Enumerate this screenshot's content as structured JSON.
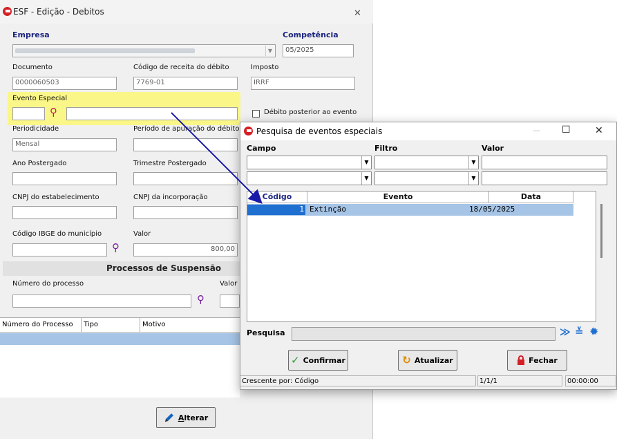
{
  "main_window": {
    "title": "ESF - Edição - Debitos",
    "close_glyph": "✕",
    "empresa_label": "Empresa",
    "empresa_value": "",
    "competencia_label": "Competência",
    "competencia_value": "05/2025",
    "documento_label": "Documento",
    "documento_value": "0000060503",
    "codigo_receita_label": "Código de receita do débito",
    "codigo_receita_value": "7769-01",
    "imposto_label": "Imposto",
    "imposto_value": "IRRF",
    "evento_especial_label": "Evento Especial",
    "debito_posterior_label": "Débito posterior ao evento",
    "periodicidade_label": "Periodicidade",
    "periodicidade_value": "Mensal",
    "periodo_apuracao_label": "Período de apuração do débito",
    "ano_postergado_label": "Ano Postergado",
    "trimestre_postergado_label": "Trimestre Postergado",
    "cnpj_estab_label": "CNPJ do estabelecimento",
    "cnpj_incorp_label": "CNPJ da incorporação",
    "codigo_ibge_label": "Código IBGE do município",
    "valor_label": "Valor",
    "valor_value": "800,00",
    "processos_section": "Processos de Suspensão",
    "numero_processo_label": "Número do processo",
    "valor2_label": "Valor",
    "grid_headers": [
      "Número do Processo",
      "Tipo",
      "Motivo"
    ],
    "alterar_label": "Alterar",
    "alterar_mnemonic": "A",
    "alterar_rest": "lterar"
  },
  "search_dialog": {
    "title": "Pesquisa de eventos especiais",
    "minimize_glyph": "—",
    "maximize_glyph": "☐",
    "close_glyph": "✕",
    "campo_label": "Campo",
    "filtro_label": "Filtro",
    "valor_label": "Valor",
    "columns": [
      "Código",
      "Evento",
      "Data"
    ],
    "rows": [
      {
        "codigo": "1",
        "evento": "Extinção",
        "data": "18/05/2025"
      }
    ],
    "pesquisa_label": "Pesquisa",
    "confirmar_label": "Confirmar",
    "atualizar_label": "Atualizar",
    "fechar_label": "Fechar",
    "status_order": "Crescente por: Código",
    "status_page": "1/1/1",
    "status_time": "00:00:00"
  },
  "colors": {
    "label_blue": "#1a237e",
    "highlight_yellow": "#fffa50",
    "selection_blue": "#a6c4e6",
    "logo_red": "#d32026",
    "icon_purple": "#7a1fa2",
    "arrow_blue": "#1a1aa8"
  }
}
